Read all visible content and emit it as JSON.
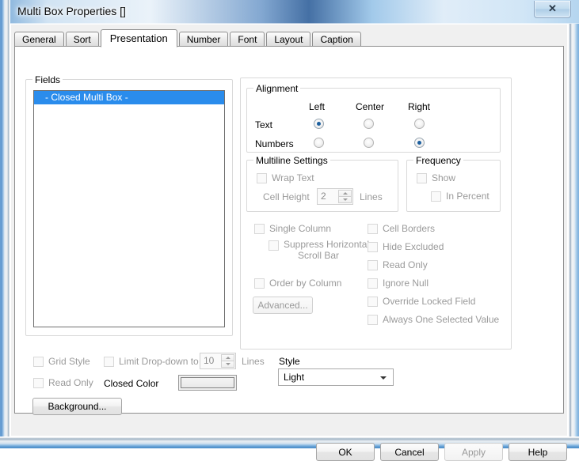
{
  "window": {
    "title": "Multi Box Properties []",
    "close_glyph": "✕"
  },
  "tabs": [
    {
      "label": "General",
      "active": false
    },
    {
      "label": "Sort",
      "active": false
    },
    {
      "label": "Presentation",
      "active": true
    },
    {
      "label": "Number",
      "active": false
    },
    {
      "label": "Font",
      "active": false
    },
    {
      "label": "Layout",
      "active": false
    },
    {
      "label": "Caption",
      "active": false
    }
  ],
  "fields": {
    "legend": "Fields",
    "items": [
      {
        "label": "- Closed Multi Box -",
        "selected": true
      }
    ]
  },
  "alignment": {
    "legend": "Alignment",
    "columns": [
      "Left",
      "Center",
      "Right"
    ],
    "rows": [
      {
        "label": "Text",
        "selected": "Left"
      },
      {
        "label": "Numbers",
        "selected": "Right"
      }
    ]
  },
  "multiline": {
    "legend": "Multiline Settings",
    "wrap_text_label": "Wrap Text",
    "wrap_text_checked": false,
    "cell_height_label": "Cell Height",
    "cell_height_value": "2",
    "lines_label": "Lines"
  },
  "frequency": {
    "legend": "Frequency",
    "show_label": "Show",
    "show_checked": false,
    "in_percent_label": "In Percent",
    "in_percent_checked": false
  },
  "options_left": [
    {
      "label": "Single Column",
      "checked": false
    },
    {
      "label": "Suppress Horizontal",
      "label2": "Scroll Bar",
      "checked": false
    },
    {
      "label": "Order by Column",
      "checked": false
    }
  ],
  "options_right": [
    {
      "label": "Cell Borders",
      "checked": false
    },
    {
      "label": "Hide Excluded",
      "checked": false
    },
    {
      "label": "Read Only",
      "checked": false
    },
    {
      "label": "Ignore Null",
      "checked": false
    },
    {
      "label": "Override Locked Field",
      "checked": false
    },
    {
      "label": "Always One Selected Value",
      "checked": false
    }
  ],
  "advanced_button": "Advanced...",
  "bottom": {
    "grid_style_label": "Grid Style",
    "grid_style_checked": false,
    "read_only_label": "Read Only",
    "read_only_checked": false,
    "limit_dropdown_label": "Limit Drop-down to",
    "limit_dropdown_checked": false,
    "limit_dropdown_value": "10",
    "limit_lines_label": "Lines",
    "closed_color_label": "Closed Color",
    "closed_color_value": "#f0f0f0",
    "style_label": "Style",
    "style_value": "Light",
    "background_button": "Background..."
  },
  "dialog_buttons": [
    {
      "label": "OK",
      "disabled": false
    },
    {
      "label": "Cancel",
      "disabled": false
    },
    {
      "label": "Apply",
      "disabled": true
    },
    {
      "label": "Help",
      "disabled": false
    }
  ]
}
